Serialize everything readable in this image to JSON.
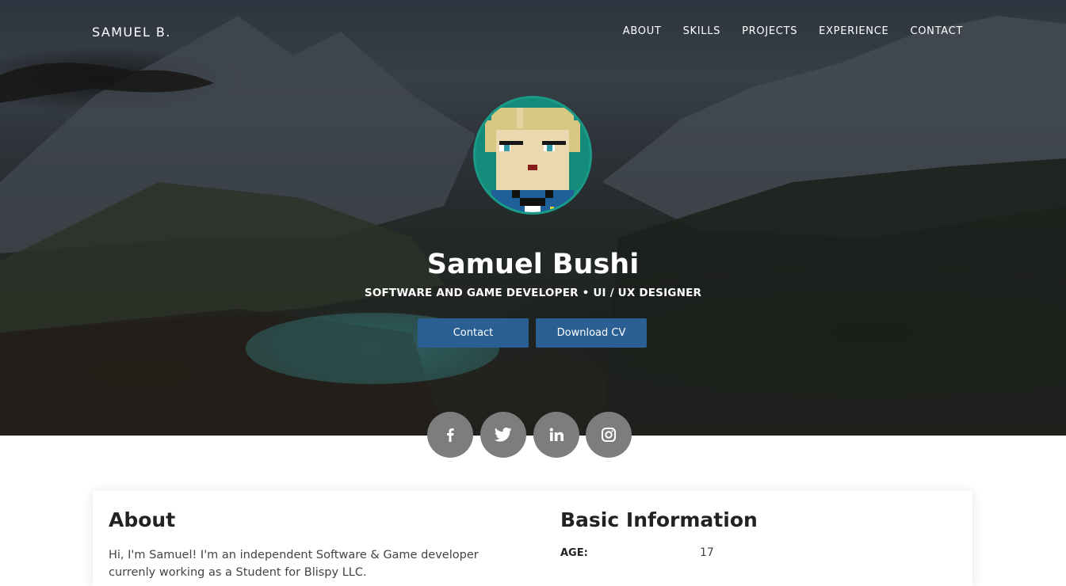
{
  "header": {
    "brand": "SAMUEL B.",
    "nav": [
      "ABOUT",
      "SKILLS",
      "PROJECTS",
      "EXPERIENCE",
      "CONTACT"
    ]
  },
  "hero": {
    "name": "Samuel Bushi",
    "tagline": "SOFTWARE AND GAME DEVELOPER • UI / UX DESIGNER",
    "buttons": {
      "contact": "Contact",
      "download_cv": "Download CV"
    },
    "social_icons": [
      "facebook-icon",
      "twitter-icon",
      "linkedin-icon",
      "instagram-icon"
    ]
  },
  "about": {
    "title": "About",
    "text": "Hi, I'm Samuel! I'm an independent Software & Game developer currenly working as a Student for Blispy LLC."
  },
  "basic_info": {
    "title": "Basic Information",
    "rows": [
      {
        "label": "AGE:",
        "value": "17"
      }
    ]
  },
  "colors": {
    "button": "#2a5f94",
    "social": "#7d7d7d",
    "avatar_bg": "#138a7a"
  }
}
